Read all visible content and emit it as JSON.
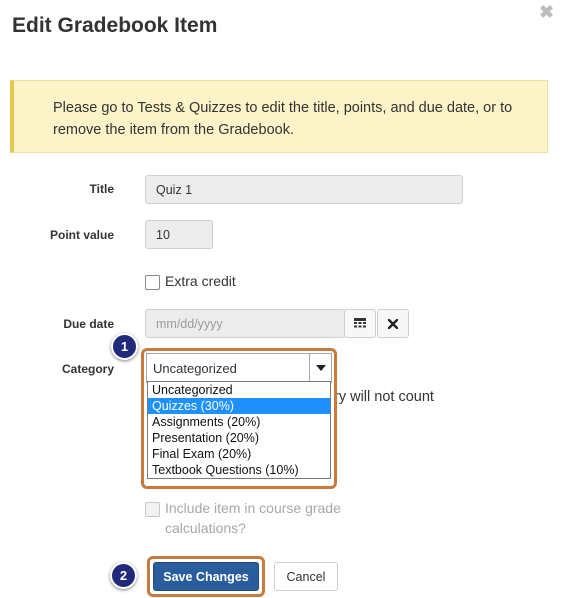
{
  "dialog": {
    "title": "Edit Gradebook Item",
    "close_glyph": "✖"
  },
  "notice": {
    "text": "Please go to Tests & Quizzes to edit the title, points, and due date, or to remove the item from the Gradebook."
  },
  "form": {
    "title_label": "Title",
    "title_value": "Quiz 1",
    "points_label": "Point value",
    "points_value": "10",
    "extra_credit_label": "Extra credit",
    "due_date_label": "Due date",
    "due_date_placeholder": "mm/dd/yyyy",
    "category_label": "Category",
    "category_selected": "Uncategorized",
    "category_options": [
      "Uncategorized",
      "Quizzes (30%)",
      "Assignments (20%)",
      "Presentation (20%)",
      "Final Exam (20%)",
      "Textbook Questions (10%)"
    ],
    "category_highlighted_index": 1,
    "partial_hidden_text": "ry will not count",
    "include_label": "Include item in course grade calculations?"
  },
  "buttons": {
    "save": "Save Changes",
    "cancel": "Cancel"
  },
  "callouts": {
    "one": "1",
    "two": "2"
  },
  "icons": {
    "calendar": "calendar-icon",
    "clear": "clear-icon",
    "dropdown": "caret-down-icon"
  },
  "colors": {
    "notice_bg": "#fcf3c8",
    "notice_border": "#e6c84f",
    "highlight_border": "#c97b3e",
    "badge_bg": "#21297a",
    "primary_btn": "#2a5d9c",
    "selected_option": "#1e90ff"
  }
}
